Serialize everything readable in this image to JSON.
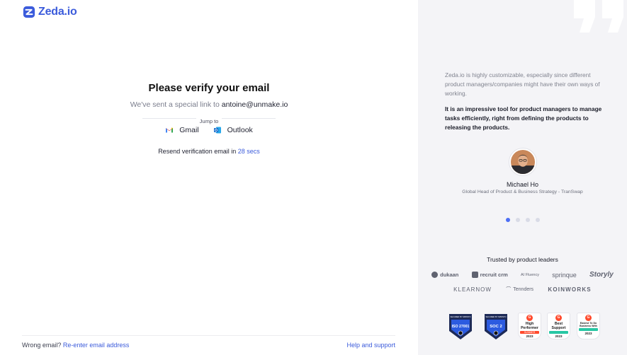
{
  "brand": {
    "name": "Zeda.io",
    "color": "#3b5bdb"
  },
  "verify": {
    "title": "Please verify your email",
    "subtitle_prefix": "We've sent a special link to",
    "email": "antoine@unmake.io",
    "jump_label": "Jump to",
    "providers": [
      {
        "label": "Gmail",
        "icon": "gmail-icon"
      },
      {
        "label": "Outlook",
        "icon": "outlook-icon"
      }
    ],
    "resend_prefix": "Resend verification email in",
    "resend_timer": "28 secs"
  },
  "footer": {
    "wrong_email": "Wrong email?",
    "reenter_link": "Re-enter email address",
    "help_link": "Help and support"
  },
  "testimonial": {
    "text_light": "Zeda.io is highly customizable, especially since different product managers/companies might have their own ways of working.",
    "text_bold": "It is an impressive tool for product managers to manage tasks efficiently, right from defining the products to releasing the products.",
    "name": "Michael Ho",
    "role": "Global Head of Product & Business Strategy - TranSwap",
    "slide_count": 4,
    "active_slide": 1
  },
  "trusted": {
    "title": "Trusted by product leaders",
    "logos_row1": [
      "dukaan",
      "recruit crm",
      "AI Fluency",
      "sprinque",
      "Storyly"
    ],
    "logos_row2": [
      "KLEARNOW",
      "Tennders",
      "KOINWORKS"
    ]
  },
  "badges": {
    "iso_top": "SECURED BY SPRINTO",
    "iso_label": "ISO 27001",
    "soc_top": "SECURED BY SPRINTO",
    "soc_label": "SOC 2",
    "g2": [
      {
        "title": "High Performer",
        "band": "SUMMER",
        "band_color": "#ff492c",
        "year": "2023"
      },
      {
        "title": "Best Support",
        "band": "",
        "band_color": "#27c7a4",
        "year": "2023"
      },
      {
        "title": "Easiest To Do Business With",
        "band": "",
        "band_color": "#27c7a4",
        "year": "2023"
      }
    ]
  }
}
